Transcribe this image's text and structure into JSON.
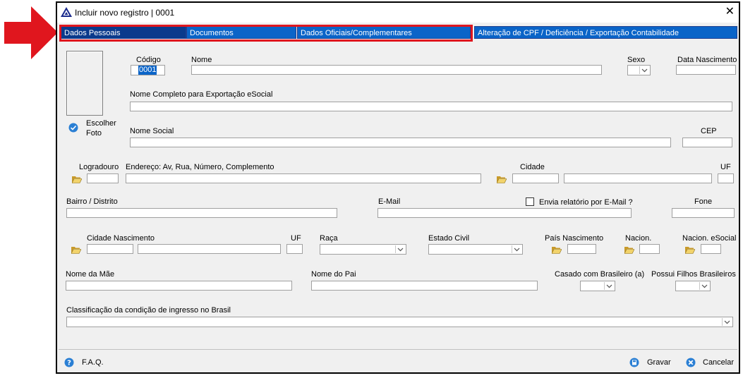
{
  "window": {
    "title": "Incluir novo registro | 0001"
  },
  "tabs": [
    {
      "label": "Dados Pessoais"
    },
    {
      "label": "Documentos"
    },
    {
      "label": "Dados Oficiais/Complementares"
    },
    {
      "label": "Alteração de CPF / Deficiência / Exportação Contabilidade"
    }
  ],
  "colors": {
    "tab_blue": "#0a64c8",
    "tab_active": "#0a3a8c",
    "highlight": "#e0161e"
  },
  "photo": {
    "choose_label_1": "Escolher",
    "choose_label_2": "Foto"
  },
  "fields": {
    "codigo": {
      "label": "Código",
      "value": "0001"
    },
    "nome": {
      "label": "Nome"
    },
    "sexo": {
      "label": "Sexo"
    },
    "data_nascimento": {
      "label": "Data Nascimento"
    },
    "nome_completo": {
      "label": "Nome Completo para Exportação eSocial"
    },
    "nome_social": {
      "label": "Nome Social"
    },
    "cep": {
      "label": "CEP"
    },
    "logradouro": {
      "label": "Logradouro"
    },
    "endereco": {
      "label": "Endereço: Av, Rua, Número, Complemento"
    },
    "cidade": {
      "label": "Cidade"
    },
    "uf": {
      "label": "UF"
    },
    "bairro": {
      "label": "Bairro / Distrito"
    },
    "email": {
      "label": "E-Mail"
    },
    "envia_relatorio": {
      "label": "Envia relatório por E-Mail ?"
    },
    "fone": {
      "label": "Fone"
    },
    "cidade_nascimento": {
      "label": "Cidade Nascimento"
    },
    "uf_nasc": {
      "label": "UF"
    },
    "raca": {
      "label": "Raça"
    },
    "estado_civil": {
      "label": "Estado Civil"
    },
    "pais_nascimento": {
      "label": "País Nascimento"
    },
    "nacion": {
      "label": "Nacion."
    },
    "nacion_esocial": {
      "label": "Nacion. eSocial"
    },
    "nome_mae": {
      "label": "Nome da Mãe"
    },
    "nome_pai": {
      "label": "Nome do Pai"
    },
    "casado_brasileiro": {
      "label": "Casado com Brasileiro (a)"
    },
    "filhos_brasileiros": {
      "label": "Possui Filhos Brasileiros"
    },
    "classificacao": {
      "label": "Classificação da condição de ingresso no Brasil"
    }
  },
  "footer": {
    "faq": "F.A.Q.",
    "gravar": "Gravar",
    "cancelar": "Cancelar"
  },
  "icons": {
    "arrow": "red-arrow-icon",
    "folder": "folder-open-icon",
    "app": "app-logo-icon"
  }
}
